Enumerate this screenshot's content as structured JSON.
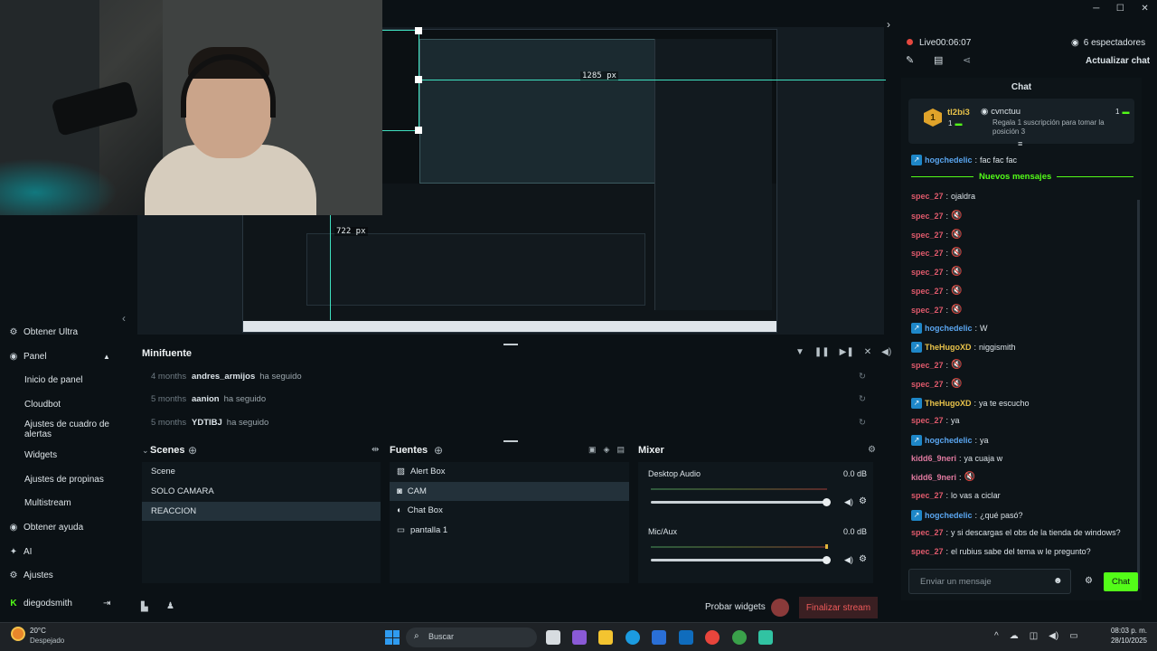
{
  "window_controls": {
    "minimize": "─",
    "maximize": "☐",
    "close": "✕"
  },
  "stream_status": {
    "live": "Live",
    "timer": "00:06:07",
    "viewers": "6 espectadores",
    "refresh_chat": "Actualizar chat"
  },
  "preview_overlay": {
    "width_readout": "1285 px",
    "height_readout": "722 px"
  },
  "sidebar": {
    "items": [
      {
        "icon": "gear-icon",
        "label": "Obtener Ultra",
        "sub": false
      },
      {
        "icon": "dashboard-icon",
        "label": "Panel",
        "sub": false
      },
      {
        "icon": "",
        "label": "Inicio de panel",
        "sub": true
      },
      {
        "icon": "",
        "label": "Cloudbot",
        "sub": true
      },
      {
        "icon": "",
        "label": "Ajustes de cuadro de alertas",
        "sub": true
      },
      {
        "icon": "",
        "label": "Widgets",
        "sub": true
      },
      {
        "icon": "",
        "label": "Ajustes de propinas",
        "sub": true
      },
      {
        "icon": "",
        "label": "Multistream",
        "sub": true
      },
      {
        "icon": "help-icon",
        "label": "Obtener ayuda",
        "sub": false
      },
      {
        "icon": "ai-icon",
        "label": "AI",
        "sub": false
      },
      {
        "icon": "settings-icon",
        "label": "Ajustes",
        "sub": false
      }
    ],
    "user": "diegodsmith"
  },
  "minifuente": {
    "title": "Minifuente",
    "rows": [
      {
        "time": "4 months",
        "user": "andres_armijos",
        "action": "ha seguido"
      },
      {
        "time": "5 months",
        "user": "aanion",
        "action": "ha seguido"
      },
      {
        "time": "5 months",
        "user": "YDTIBJ",
        "action": "ha seguido"
      }
    ]
  },
  "scenes": {
    "title": "Scenes",
    "items": [
      "Scene",
      "SOLO CAMARA",
      "REACCION"
    ],
    "selected": 2
  },
  "fuentes": {
    "title": "Fuentes",
    "items": [
      {
        "icon": "image-icon",
        "label": "Alert Box"
      },
      {
        "icon": "camera-icon",
        "label": "CAM"
      },
      {
        "icon": "chat-icon",
        "label": "Chat Box"
      },
      {
        "icon": "monitor-icon",
        "label": "pantalla 1"
      }
    ],
    "selected": 1
  },
  "mixer": {
    "title": "Mixer",
    "channels": [
      {
        "name": "Desktop Audio",
        "level": "0.0 dB",
        "volume": 1.0
      },
      {
        "name": "Mic/Aux",
        "level": "0.0 dB",
        "volume": 1.0
      }
    ]
  },
  "footer": {
    "test_widgets": "Probar widgets",
    "end_stream": "Finalizar stream"
  },
  "chat": {
    "title": "Chat",
    "pinned": {
      "rank": "1",
      "user": "tl2bi3",
      "count_left": "1",
      "gifter": "cvnctuu",
      "count_right": "1",
      "text": "Regala 1 suscripción para tomar la posición 3"
    },
    "new_messages": "Nuevos mensajes",
    "messages": [
      {
        "user": "hogchedelic",
        "color": "#5aa6f0",
        "badge": true,
        "text": "fac fac fac",
        "emote": false
      },
      {
        "user": "spec_27",
        "color": "#e05a6c",
        "badge": false,
        "text": "ojaldra",
        "emote": false
      },
      {
        "user": "spec_27",
        "color": "#e05a6c",
        "badge": false,
        "text": "",
        "emote": true
      },
      {
        "user": "spec_27",
        "color": "#e05a6c",
        "badge": false,
        "text": "",
        "emote": true
      },
      {
        "user": "spec_27",
        "color": "#e05a6c",
        "badge": false,
        "text": "",
        "emote": true
      },
      {
        "user": "spec_27",
        "color": "#e05a6c",
        "badge": false,
        "text": "",
        "emote": true
      },
      {
        "user": "spec_27",
        "color": "#e05a6c",
        "badge": false,
        "text": "",
        "emote": true
      },
      {
        "user": "spec_27",
        "color": "#e05a6c",
        "badge": false,
        "text": "",
        "emote": true
      },
      {
        "user": "hogchedelic",
        "color": "#5aa6f0",
        "badge": true,
        "text": "W",
        "emote": false
      },
      {
        "user": "TheHugoXD",
        "color": "#e8c24a",
        "badge": true,
        "text": "niggismith",
        "emote": false
      },
      {
        "user": "spec_27",
        "color": "#e05a6c",
        "badge": false,
        "text": "",
        "emote": true
      },
      {
        "user": "spec_27",
        "color": "#e05a6c",
        "badge": false,
        "text": "",
        "emote": true
      },
      {
        "user": "TheHugoXD",
        "color": "#e8c24a",
        "badge": true,
        "text": "ya te escucho",
        "emote": false
      },
      {
        "user": "spec_27",
        "color": "#e05a6c",
        "badge": false,
        "text": "ya",
        "emote": false
      },
      {
        "user": "hogchedelic",
        "color": "#5aa6f0",
        "badge": true,
        "text": "ya",
        "emote": false
      },
      {
        "user": "kidd6_9neri",
        "color": "#e07aa0",
        "badge": false,
        "text": "ya cuaja w",
        "emote": false
      },
      {
        "user": "kidd6_9neri",
        "color": "#e07aa0",
        "badge": false,
        "text": "",
        "emote": true
      },
      {
        "user": "spec_27",
        "color": "#e05a6c",
        "badge": false,
        "text": "lo vas a ciclar",
        "emote": false
      },
      {
        "user": "hogchedelic",
        "color": "#5aa6f0",
        "badge": true,
        "text": "¿qué pasó?",
        "emote": false
      },
      {
        "user": "spec_27",
        "color": "#e05a6c",
        "badge": false,
        "text": "y si descargas el obs de la tienda de windows?",
        "emote": false
      },
      {
        "user": "spec_27",
        "color": "#e05a6c",
        "badge": false,
        "text": "el rubius sabe del tema w le pregunto?",
        "emote": false
      }
    ],
    "input_placeholder": "Enviar un mensaje",
    "send": "Chat"
  },
  "taskbar": {
    "weather_temp": "20°C",
    "weather_desc": "Despejado",
    "search_placeholder": "Buscar",
    "time": "08:03 p. m.",
    "date": "28/10/2025"
  },
  "colors": {
    "accent": "#31c3a2",
    "live": "#e5483f",
    "green": "#53fc18",
    "end_stream": "#ee5a5a"
  }
}
